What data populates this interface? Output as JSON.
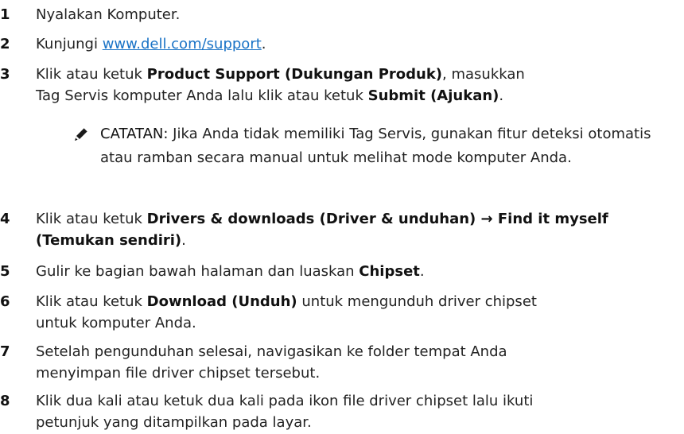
{
  "steps": [
    {
      "num": "1",
      "text": "Nyalakan Komputer."
    },
    {
      "num": "2",
      "pre": "Kunjungi ",
      "link": "www.dell.com/support",
      "post": "."
    },
    {
      "num": "3",
      "t1": "Klik atau ketuk ",
      "b1": "Product Support (Dukungan Produk)",
      "t2": ", masukkan Tag Servis komputer Anda lalu klik atau ketuk ",
      "b2": "Submit (Ajukan)",
      "t3": "."
    },
    {
      "num": "4",
      "t1": "Klik atau ketuk ",
      "b1": "Drivers & downloads (Driver & unduhan) → Find it myself (Temukan sendiri)",
      "t2": "."
    },
    {
      "num": "5",
      "t1": "Gulir ke bagian bawah halaman dan luaskan ",
      "b1": "Chipset",
      "t2": "."
    },
    {
      "num": "6",
      "t1": "Klik atau ketuk ",
      "b1": "Download (Unduh)",
      "t2": " untuk mengunduh driver chipset untuk komputer Anda."
    },
    {
      "num": "7",
      "text": "Setelah pengunduhan selesai, navigasikan ke folder tempat Anda menyimpan file driver chipset tersebut."
    },
    {
      "num": "8",
      "text": "Klik dua kali atau ketuk dua kali pada ikon file driver chipset lalu ikuti petunjuk yang ditampilkan pada layar."
    }
  ],
  "note": {
    "label": "CATATAN:",
    "text": " Jika Anda tidak memiliki Tag Servis, gunakan fitur deteksi otomatis atau ramban secara manual untuk melihat mode komputer Anda.",
    "icon": "pencil-note-icon"
  }
}
